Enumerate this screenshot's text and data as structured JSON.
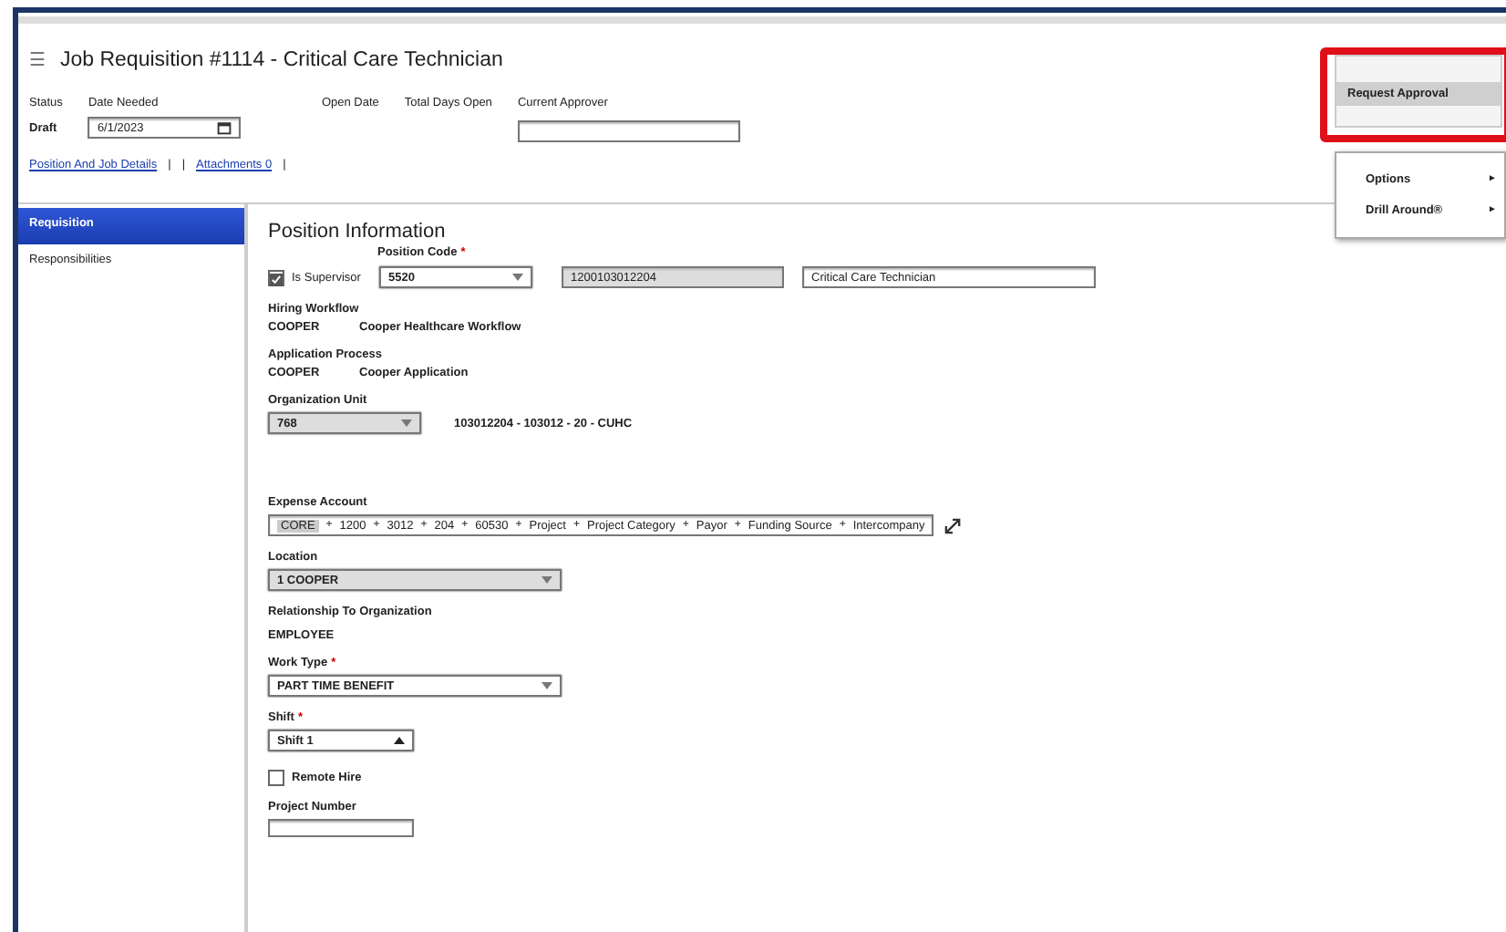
{
  "header": {
    "menu_glyph": "☰",
    "title": "Job Requisition #1114 - Critical Care Technician"
  },
  "summary": {
    "status_label": "Status",
    "status": "Draft",
    "date_needed_label": "Date Needed",
    "date_needed": "6/1/2023",
    "open_date_label": "Open Date",
    "total_days_label": "Total Days Open",
    "approver_label": "Current Approver"
  },
  "link_bar": [
    {
      "kind": "link",
      "text": "Position And Job Details"
    },
    {
      "kind": "sep",
      "text": "|"
    },
    {
      "kind": "sep",
      "text": "|"
    },
    {
      "kind": "link",
      "text": "Attachments 0"
    },
    {
      "kind": "sep",
      "text": "|"
    }
  ],
  "actions_menu": {
    "items": [
      {
        "label": "Request Approval",
        "selected": true
      }
    ]
  },
  "context_menu": {
    "items": [
      {
        "label": "Options",
        "arrow": "►"
      },
      {
        "label": "Drill Around®",
        "arrow": "►"
      }
    ]
  },
  "sidebar": {
    "items": [
      {
        "label": "Requisition",
        "selected": true
      },
      {
        "label": "Responsibilities",
        "selected": false
      }
    ]
  },
  "form": {
    "title": "Position Information",
    "supervisor": {
      "label": "Is Supervisor",
      "checked": true
    },
    "position_code": {
      "label": "Position Code",
      "required_mark": "*",
      "value": "5520",
      "number": "1200103012204",
      "name": "Critical Care Technician"
    },
    "hiring_workflow": {
      "label": "Hiring Workflow",
      "code": "COOPER",
      "name": "Cooper Healthcare Workflow"
    },
    "application_process": {
      "label": "Application Process",
      "code": "COOPER",
      "name": "Cooper Application"
    },
    "organization_unit": {
      "label": "Organization Unit",
      "value": "768",
      "description": "103012204 - 103012 - 20 - CUHC"
    },
    "expense_account": {
      "label": "Expense Account",
      "separator": "+",
      "segments": [
        "CORE",
        "1200",
        "3012",
        "204",
        "60530",
        "Project",
        "Project Category",
        "Payor",
        "Funding Source",
        "Intercompany"
      ]
    },
    "location": {
      "label": "Location",
      "value": "1 COOPER"
    },
    "relationship": {
      "label": "Relationship To Organization",
      "value": "EMPLOYEE"
    },
    "work_type": {
      "label": "Work Type",
      "required_mark": "*",
      "value": "PART TIME BENEFIT"
    },
    "shift": {
      "label": "Shift",
      "required_mark": "*",
      "value": "Shift 1"
    },
    "remote_hire": {
      "label": "Remote Hire",
      "checked": false
    },
    "project_number": {
      "label": "Project Number"
    }
  }
}
